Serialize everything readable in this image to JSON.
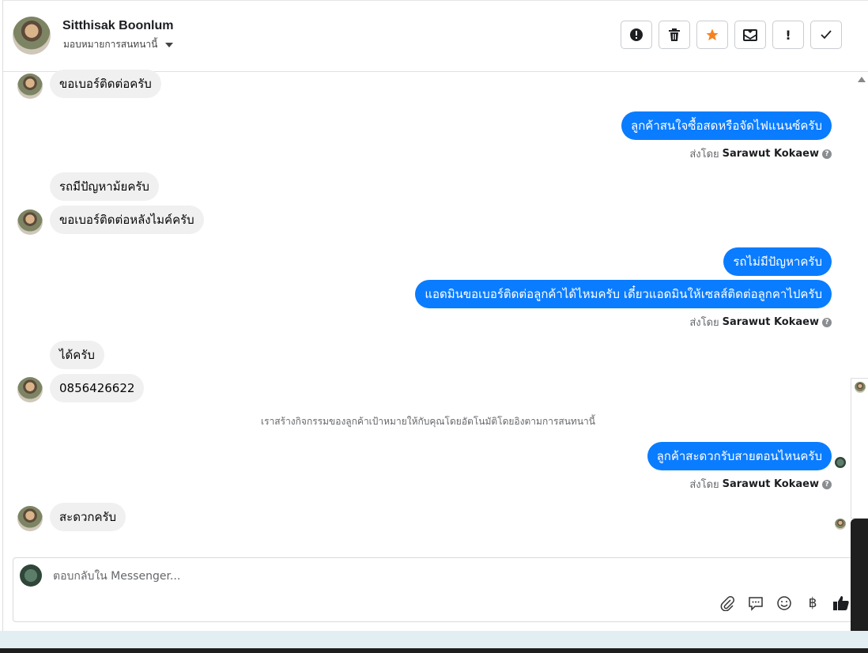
{
  "header": {
    "contact_name": "Sitthisak Boonlum",
    "assign_label": "มอบหมายการสนทนานี้",
    "actions": [
      {
        "name": "alert-circle-icon",
        "glyph": "!"
      },
      {
        "name": "trash-icon",
        "glyph": "🗑"
      },
      {
        "name": "star-icon",
        "glyph": "★"
      },
      {
        "name": "mail-archive-icon",
        "glyph": "✉"
      },
      {
        "name": "exclamation-icon",
        "glyph": "!"
      },
      {
        "name": "check-icon",
        "glyph": "✓"
      }
    ]
  },
  "messages": {
    "m1": "ขอเบอร์ติดต่อครับ",
    "m2": "ลูกค้าสนใจซื้อสดหรือจัดไฟแนนซ์ครับ",
    "m3": "รถมีปัญหาม้ยครับ",
    "m4": "ขอเบอร์ติดต่อหลังไมค์ครับ",
    "m5": "รถไม่มีปัญหาครับ",
    "m6": "แอดมินขอเบอร์ติดต่อลูกค้าได้ไหมครับ เดี๋ยวแอดมินให้เซลส์ติดต่อลูกคาไปครับ",
    "m7": "ได้ครับ",
    "m8": "0856426622",
    "m9": "ลูกค้าสะดวกรับสายตอนไหนครับ",
    "m10": "สะดวกครับ"
  },
  "sent_by_prefix": "ส่งโดย",
  "sent_by_name": "Sarawut Kokaew",
  "help_glyph": "?",
  "system_note": "เราสร้างกิจกรรมของลูกค้าเป้าหมายให้กับคุณโดยอัตโนมัติโดยอิงตามการสนทนานี้",
  "composer": {
    "placeholder": "ตอบกลับใน Messenger...",
    "tools": [
      "paperclip-icon",
      "speech-bubble-icon",
      "smiley-icon",
      "baht-icon",
      "thumbs-up-icon"
    ],
    "baht_glyph": "฿"
  },
  "colors": {
    "outgoing_bubble": "#0a7cff",
    "incoming_bubble": "#f0f0f0",
    "star": "#f5821f"
  }
}
